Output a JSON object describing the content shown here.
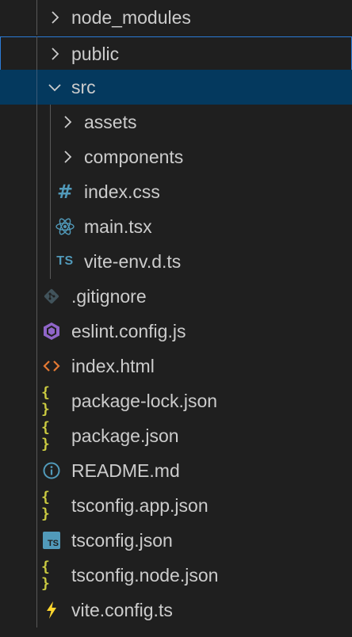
{
  "explorer": {
    "items": [
      {
        "label": "node_modules",
        "kind": "folder",
        "expanded": false,
        "icon": "chevron-right-icon"
      },
      {
        "label": "public",
        "kind": "folder",
        "expanded": false,
        "icon": "chevron-right-icon",
        "state": "focused"
      },
      {
        "label": "src",
        "kind": "folder",
        "expanded": true,
        "icon": "chevron-down-icon",
        "state": "selected"
      },
      {
        "label": "assets",
        "kind": "folder",
        "expanded": false,
        "icon": "chevron-right-icon"
      },
      {
        "label": "components",
        "kind": "folder",
        "expanded": false,
        "icon": "chevron-right-icon"
      },
      {
        "label": "index.css",
        "kind": "file",
        "icon": "css-hash-icon",
        "icon_text": "#"
      },
      {
        "label": "main.tsx",
        "kind": "file",
        "icon": "react-atom-icon"
      },
      {
        "label": "vite-env.d.ts",
        "kind": "file",
        "icon": "typescript-text-icon",
        "icon_text": "TS"
      },
      {
        "label": ".gitignore",
        "kind": "file",
        "icon": "git-icon"
      },
      {
        "label": "eslint.config.js",
        "kind": "file",
        "icon": "eslint-icon"
      },
      {
        "label": "index.html",
        "kind": "file",
        "icon": "html-brackets-icon"
      },
      {
        "label": "package-lock.json",
        "kind": "file",
        "icon": "json-braces-icon",
        "icon_text": "{ }"
      },
      {
        "label": "package.json",
        "kind": "file",
        "icon": "json-braces-icon",
        "icon_text": "{ }"
      },
      {
        "label": "README.md",
        "kind": "file",
        "icon": "info-icon"
      },
      {
        "label": "tsconfig.app.json",
        "kind": "file",
        "icon": "json-braces-icon",
        "icon_text": "{ }"
      },
      {
        "label": "tsconfig.json",
        "kind": "file",
        "icon": "tsconfig-icon",
        "icon_text": "TS"
      },
      {
        "label": "tsconfig.node.json",
        "kind": "file",
        "icon": "json-braces-icon",
        "icon_text": "{ }"
      },
      {
        "label": "vite.config.ts",
        "kind": "file",
        "icon": "vite-bolt-icon"
      }
    ]
  },
  "colors": {
    "background": "#1f1f1f",
    "selected_row": "#04395e",
    "focus_border": "#2b7bd6",
    "text": "#cccccc",
    "ts_blue": "#519aba",
    "json_yellow": "#cbcb41",
    "html_orange": "#e37933",
    "eslint_purple": "#8f65c8",
    "git_gray": "#41535b",
    "vite_yellow": "#ffd62e"
  }
}
